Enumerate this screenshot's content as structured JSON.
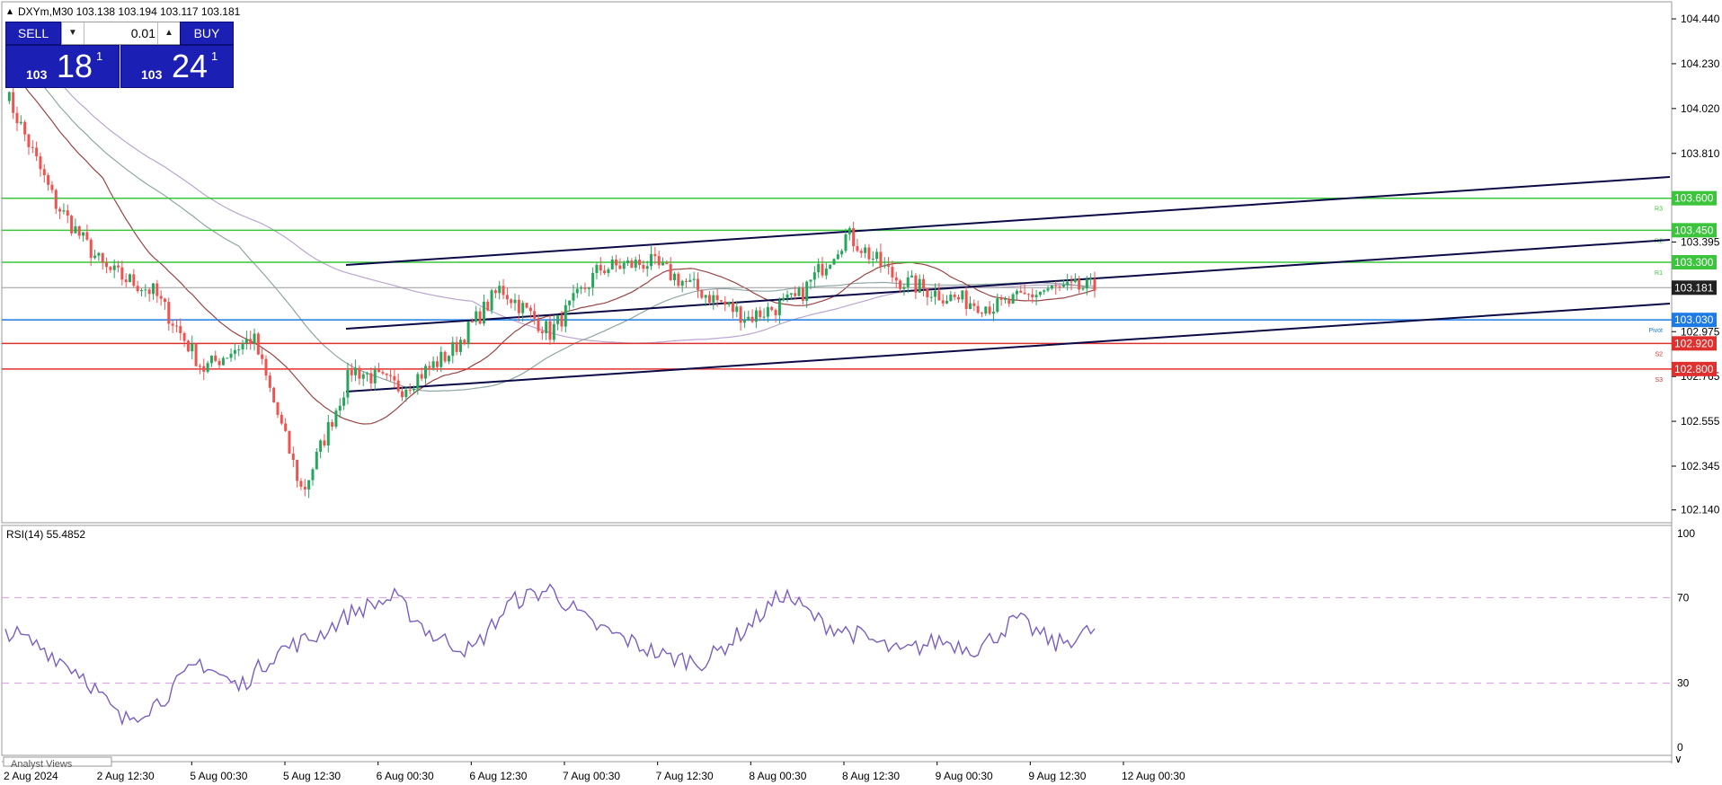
{
  "symbol_info": "DXYm,M30  103.138 103.194 103.117 103.181",
  "trade_panel": {
    "sell_label": "SELL",
    "buy_label": "BUY",
    "lot_value": "0.01",
    "sell_price": {
      "small": "103",
      "big": "18",
      "sup": "1"
    },
    "buy_price": {
      "small": "103",
      "big": "24",
      "sup": "1"
    }
  },
  "price_axis": {
    "ticks": [
      "104.440",
      "104.230",
      "104.020",
      "103.810",
      "103.395",
      "102.975",
      "102.765",
      "102.555",
      "102.345",
      "102.140"
    ]
  },
  "levels": [
    {
      "label": "103.600",
      "tag": "R3",
      "price": 103.6,
      "color": "#3cc43c"
    },
    {
      "label": "103.450",
      "tag": "R2",
      "price": 103.45,
      "color": "#3cc43c"
    },
    {
      "label": "103.300",
      "tag": "R1",
      "price": 103.3,
      "color": "#3cc43c"
    },
    {
      "label": "103.030",
      "tag": "Pivot",
      "price": 103.03,
      "color": "#1e7be6"
    },
    {
      "label": "102.920",
      "tag": "S2",
      "price": 102.92,
      "color": "#e0302e"
    },
    {
      "label": "102.800",
      "tag": "S3",
      "price": 102.8,
      "color": "#e0302e"
    }
  ],
  "current_price": {
    "label": "103.181",
    "price": 103.181
  },
  "rsi": {
    "label": "RSI(14) 55.4852",
    "ticks": [
      "100",
      "70",
      "30",
      "0"
    ],
    "levels": [
      70,
      30
    ],
    "scale_marker": "∨"
  },
  "time_axis": [
    "2 Aug 2024",
    "2 Aug 12:30",
    "5 Aug 00:30",
    "5 Aug 12:30",
    "6 Aug 00:30",
    "6 Aug 12:30",
    "7 Aug 00:30",
    "7 Aug 12:30",
    "8 Aug 00:30",
    "8 Aug 12:30",
    "9 Aug 00:30",
    "9 Aug 12:30",
    "12 Aug 00:30"
  ],
  "bottom_tab": "Analyst Views",
  "colors": {
    "bull": "#26a65b",
    "bear": "#ef5350",
    "channel": "#0a0a46",
    "rsi_line": "#7b5fc0",
    "rsi_levels": "#d59be0",
    "ma_slow": "#b9a6cf",
    "ma_mid": "#8fa6a6",
    "ma_fast": "#9a4444",
    "button": "#1b1fb4"
  },
  "chart_data": {
    "type": "candlestick",
    "symbol": "DXYm",
    "timeframe": "M30",
    "ohlc_last": {
      "open": 103.138,
      "high": 103.194,
      "low": 103.117,
      "close": 103.181
    },
    "ylim": [
      102.08,
      104.52
    ],
    "close_path": [
      {
        "x": "2 Aug 2024",
        "y": 104.1
      },
      {
        "x": "2 Aug 12:30",
        "y": 103.58
      },
      {
        "x": "2 Aug 12:30",
        "y": 103.27
      },
      {
        "x": "5 Aug 00:30",
        "y": 103.16
      },
      {
        "x": "5 Aug 00:30",
        "y": 102.8
      },
      {
        "x": "5 Aug 00:30",
        "y": 102.95
      },
      {
        "x": "5 Aug 12:30",
        "y": 102.22
      },
      {
        "x": "5 Aug 12:30",
        "y": 102.8
      },
      {
        "x": "6 Aug 00:30",
        "y": 102.71
      },
      {
        "x": "6 Aug 00:30",
        "y": 102.88
      },
      {
        "x": "6 Aug 12:30",
        "y": 103.18
      },
      {
        "x": "6 Aug 12:30",
        "y": 102.97
      },
      {
        "x": "7 Aug 00:30",
        "y": 103.27
      },
      {
        "x": "7 Aug 00:30",
        "y": 103.3
      },
      {
        "x": "7 Aug 12:30",
        "y": 103.17
      },
      {
        "x": "8 Aug 00:30",
        "y": 103.04
      },
      {
        "x": "8 Aug 00:30",
        "y": 103.13
      },
      {
        "x": "8 Aug 12:30",
        "y": 103.43
      },
      {
        "x": "8 Aug 12:30",
        "y": 103.22
      },
      {
        "x": "9 Aug 00:30",
        "y": 103.14
      },
      {
        "x": "9 Aug 12:30",
        "y": 103.09
      },
      {
        "x": "9 Aug 12:30",
        "y": 103.17
      },
      {
        "x": "12 Aug 00:30",
        "y": 103.181
      }
    ],
    "rsi_path": [
      55,
      46,
      34,
      12,
      22,
      40,
      28,
      45,
      52,
      64,
      70,
      52,
      45,
      68,
      74,
      58,
      50,
      42,
      40,
      55,
      72,
      58,
      52,
      44,
      50,
      46,
      60,
      48,
      55
    ]
  }
}
